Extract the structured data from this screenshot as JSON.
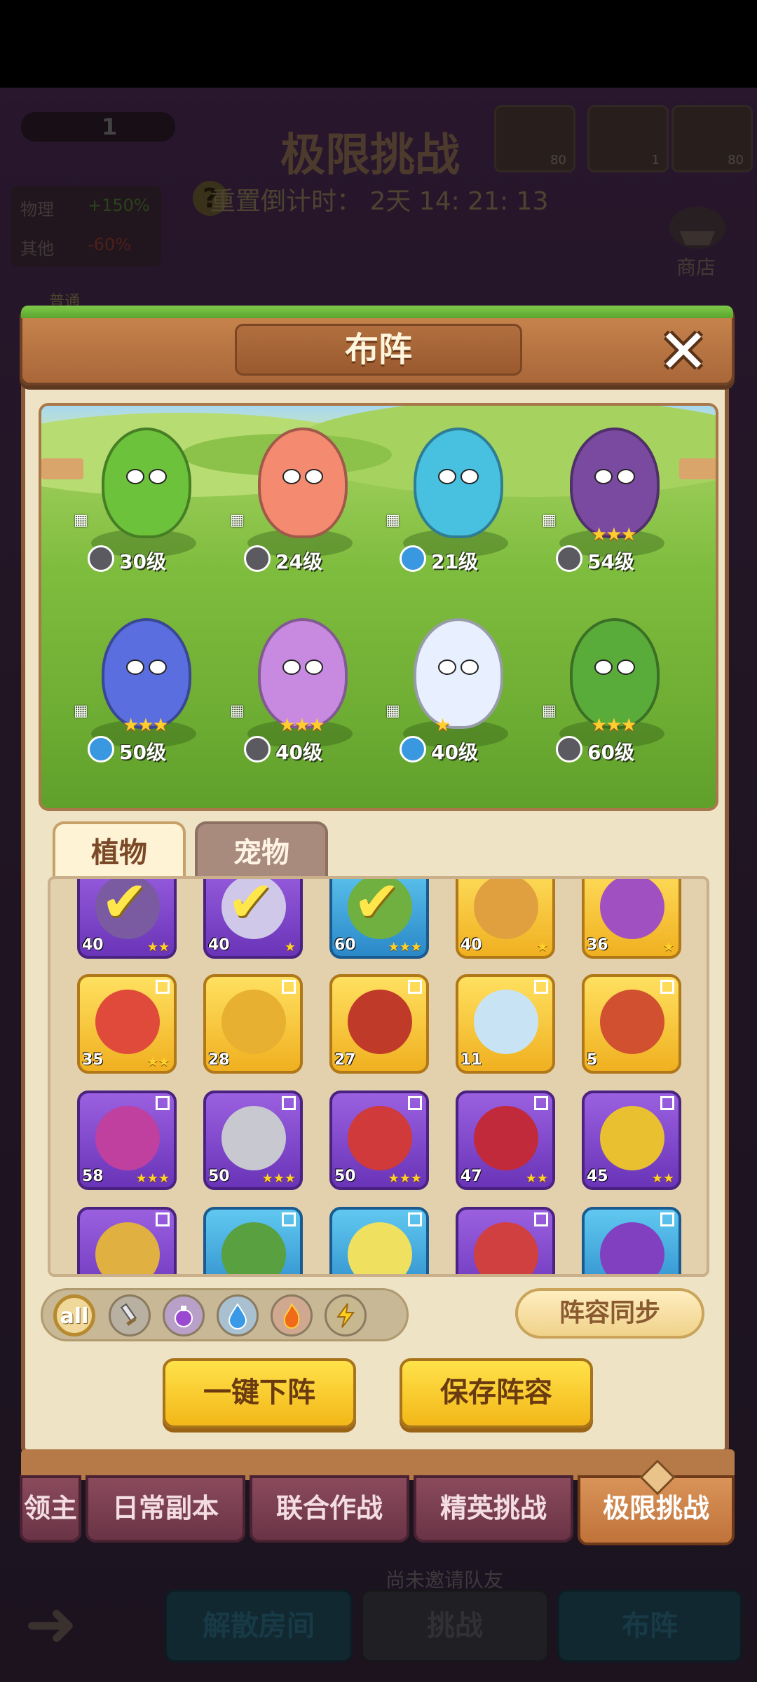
{
  "background": {
    "title": "极限挑战",
    "help_icon": "?",
    "reset_timer": "重置倒计时： 2天 14: 21: 13",
    "player_level": "1",
    "stats": [
      {
        "label": "物理",
        "value": "+150%"
      },
      {
        "label": "其他",
        "value": "-60%"
      }
    ],
    "mode_tag": "普通",
    "shop_label": "商店",
    "resources": [
      "80",
      "1",
      "80"
    ],
    "invite_text": "尚未邀请队友",
    "buttons": [
      "解散房间",
      "挑战",
      "布阵"
    ]
  },
  "dialog": {
    "title": "布阵",
    "close_icon": "close-x"
  },
  "lineup": [
    {
      "level": "30级",
      "element": "sword",
      "stars": "",
      "color": "#6cc23a"
    },
    {
      "level": "24级",
      "element": "sword",
      "stars": "",
      "color": "#f48a70"
    },
    {
      "level": "21级",
      "element": "water",
      "stars": "",
      "color": "#48c0e0"
    },
    {
      "level": "54级",
      "element": "sword",
      "stars": "★★★",
      "color": "#7a4aa0"
    },
    {
      "level": "50级",
      "element": "water",
      "stars": "★★★",
      "color": "#5a6ee0"
    },
    {
      "level": "40级",
      "element": "sword",
      "stars": "★★★",
      "color": "#c88ae0"
    },
    {
      "level": "40级",
      "element": "water",
      "stars": "★",
      "color": "#e8f0ff"
    },
    {
      "level": "60级",
      "element": "sword",
      "stars": "★★★",
      "color": "#5aac3a"
    }
  ],
  "tabs": {
    "plants": "植物",
    "pets": "宠物"
  },
  "roster": [
    [
      {
        "level": "40",
        "stars": "★★",
        "frame": "purple",
        "checked": true,
        "color": "#7a5aa0"
      },
      {
        "level": "40",
        "stars": "★",
        "frame": "purple",
        "checked": true,
        "color": "#d0c8e8"
      },
      {
        "level": "60",
        "stars": "★★★",
        "frame": "blue",
        "checked": true,
        "color": "#70b040"
      },
      {
        "level": "40",
        "stars": "★",
        "frame": "gold",
        "checked": false,
        "color": "#e0a040"
      },
      {
        "level": "36",
        "stars": "★",
        "frame": "gold",
        "checked": false,
        "color": "#a050c0"
      }
    ],
    [
      {
        "level": "35",
        "stars": "★★",
        "frame": "gold",
        "checked": false,
        "color": "#e04a3a"
      },
      {
        "level": "28",
        "stars": "",
        "frame": "gold",
        "checked": false,
        "color": "#e8b030"
      },
      {
        "level": "27",
        "stars": "",
        "frame": "gold",
        "checked": false,
        "color": "#c03a2a"
      },
      {
        "level": "11",
        "stars": "",
        "frame": "gold",
        "checked": false,
        "color": "#c8e4f4"
      },
      {
        "level": "5",
        "stars": "",
        "frame": "gold",
        "checked": false,
        "color": "#d05030"
      }
    ],
    [
      {
        "level": "58",
        "stars": "★★★",
        "frame": "purple",
        "checked": false,
        "color": "#c040a0"
      },
      {
        "level": "50",
        "stars": "★★★",
        "frame": "purple",
        "checked": false,
        "color": "#c8c8d0"
      },
      {
        "level": "50",
        "stars": "★★★",
        "frame": "purple",
        "checked": false,
        "color": "#d03a3a"
      },
      {
        "level": "47",
        "stars": "★★",
        "frame": "purple",
        "checked": false,
        "color": "#c02a3a"
      },
      {
        "level": "45",
        "stars": "★★",
        "frame": "purple",
        "checked": false,
        "color": "#e8c030"
      }
    ],
    [
      {
        "level": "",
        "stars": "",
        "frame": "purple",
        "checked": false,
        "color": "#e0b040"
      },
      {
        "level": "",
        "stars": "",
        "frame": "blue",
        "checked": false,
        "color": "#58a040"
      },
      {
        "level": "",
        "stars": "",
        "frame": "blue",
        "checked": false,
        "color": "#f0e060"
      },
      {
        "level": "",
        "stars": "",
        "frame": "purple",
        "checked": false,
        "color": "#d04040"
      },
      {
        "level": "",
        "stars": "",
        "frame": "blue",
        "checked": false,
        "color": "#8040c0"
      }
    ]
  ],
  "filters": {
    "all": "all",
    "icons": [
      "sword-icon",
      "potion-icon",
      "water-drop-icon",
      "fire-icon",
      "lightning-icon"
    ]
  },
  "buttons": {
    "sync": "阵容同步",
    "unequip_all": "一键下阵",
    "save_lineup": "保存阵容"
  },
  "bottom_tabs": [
    "领主",
    "日常副本",
    "联合作战",
    "精英挑战",
    "极限挑战"
  ],
  "colors": {
    "panel": "#efe3c6",
    "header": "#b9764a",
    "button_yellow": "#f7c92a",
    "active_tab": "#cf8550"
  }
}
